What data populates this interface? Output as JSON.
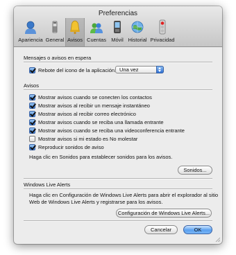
{
  "window": {
    "title": "Preferencias"
  },
  "toolbar": {
    "items": [
      {
        "label": "Apariencia",
        "icon": "apariencia-icon",
        "selected": false
      },
      {
        "label": "General",
        "icon": "general-switch-icon",
        "selected": false
      },
      {
        "label": "Avisos",
        "icon": "bell-icon",
        "selected": true
      },
      {
        "label": "Cuentas",
        "icon": "cuentas-icon",
        "selected": false
      },
      {
        "label": "Móvil",
        "icon": "mobile-phone-icon",
        "selected": false
      },
      {
        "label": "Historial",
        "icon": "history-globe-icon",
        "selected": false
      },
      {
        "label": "Privacidad",
        "icon": "privacy-traffic-light-icon",
        "selected": false
      }
    ]
  },
  "messages_section": {
    "title": "Mensajes o avisos en espera",
    "bounce_label": "Rebote del icono de la aplicación:",
    "bounce_checked": true,
    "bounce_value": "Una vez"
  },
  "alerts_section": {
    "title": "Avisos",
    "options": [
      {
        "label": "Mostrar avisos cuando se conecten los contactos",
        "checked": true
      },
      {
        "label": "Mostrar avisos al recibir un mensaje instantáneo",
        "checked": true
      },
      {
        "label": "Mostrar avisos al recibir correo electrónico",
        "checked": true
      },
      {
        "label": "Mostrar avisos cuando se reciba una llamada entrante",
        "checked": true
      },
      {
        "label": "Mostrar avisos cuando se reciba una videoconferencia entrante",
        "checked": true
      },
      {
        "label": "Mostrar avisos si mi estado es No molestar",
        "checked": false
      },
      {
        "label": "Reproducir sonidos de aviso",
        "checked": true
      }
    ],
    "sounds_hint": "Haga clic en Sonidos para establecer sonidos para los avisos.",
    "sounds_button": "Sonidos..."
  },
  "wla_section": {
    "title": "Windows Live Alerts",
    "description_line1": "Haga clic en Configuración de Windows Live Alerts para abrir el explorador al sitio",
    "description_line2": "Web de Windows Live Alerts y registrarse para los avisos.",
    "config_button": "Configuración de Windows Live Alerts..."
  },
  "footer": {
    "cancel_label": "Cancelar",
    "ok_label": "OK"
  },
  "colors": {
    "accent": "#3b7fd8",
    "window_bg": "#ececec"
  }
}
